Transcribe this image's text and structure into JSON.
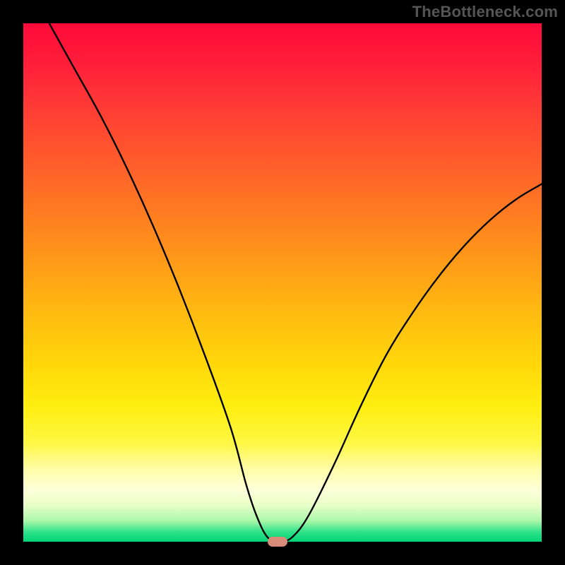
{
  "watermark": "TheBottleneck.com",
  "chart_data": {
    "type": "line",
    "title": "",
    "xlabel": "",
    "ylabel": "",
    "xlim": [
      0,
      100
    ],
    "ylim": [
      0,
      100
    ],
    "grid": false,
    "series": [
      {
        "name": "bottleneck-curve",
        "x": [
          5,
          10,
          15,
          20,
          25,
          30,
          35,
          40,
          43,
          45,
          47,
          49,
          50,
          52,
          55,
          60,
          65,
          70,
          75,
          80,
          85,
          90,
          95,
          100
        ],
        "y": [
          100,
          91,
          82,
          72,
          61,
          49,
          36,
          22,
          11,
          5,
          1,
          0,
          0,
          1,
          5,
          15,
          26,
          36,
          44,
          51,
          57,
          62,
          66,
          69
        ]
      }
    ],
    "annotations": [
      {
        "name": "optimal-marker",
        "x": 49,
        "y": 0
      }
    ],
    "background_gradient": {
      "top": "#ff0a3a",
      "mid": "#ffee10",
      "bottom": "#00d376"
    }
  }
}
